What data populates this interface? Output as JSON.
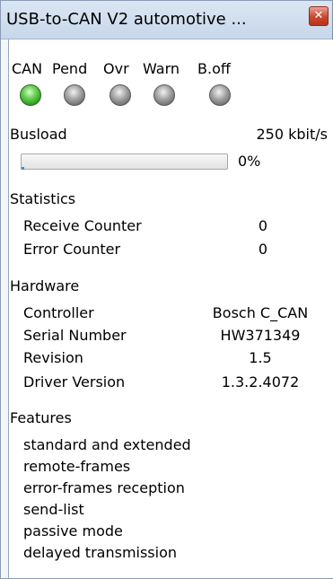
{
  "window": {
    "title": "USB-to-CAN V2 automotive ..."
  },
  "leds": [
    {
      "label": "CAN",
      "state": "on"
    },
    {
      "label": "Pend",
      "state": "off"
    },
    {
      "label": "Ovr",
      "state": "off"
    },
    {
      "label": "Warn",
      "state": "off"
    },
    {
      "label": "B.off",
      "state": "off"
    }
  ],
  "busload": {
    "label": "Busload",
    "rate": "250 kbit/s",
    "percent_text": "0%",
    "percent": 0
  },
  "statistics": {
    "heading": "Statistics",
    "rows": [
      {
        "label": "Receive Counter",
        "value": "0"
      },
      {
        "label": "Error Counter",
        "value": "0"
      }
    ]
  },
  "hardware": {
    "heading": "Hardware",
    "rows": [
      {
        "label": "Controller",
        "value": "Bosch C_CAN"
      },
      {
        "label": "Serial Number",
        "value": "HW371349"
      },
      {
        "label": "Revision",
        "value": "1.5"
      },
      {
        "label": "Driver Version",
        "value": "1.3.2.4072"
      }
    ]
  },
  "features": {
    "heading": "Features",
    "items": [
      "standard and extended",
      "remote-frames",
      "error-frames reception",
      "send-list",
      "passive mode",
      "delayed transmission"
    ]
  },
  "colors": {
    "led_on": "#3fb52c",
    "led_off": "#7a7a7a",
    "progress_accent": "#3c8ce8"
  }
}
